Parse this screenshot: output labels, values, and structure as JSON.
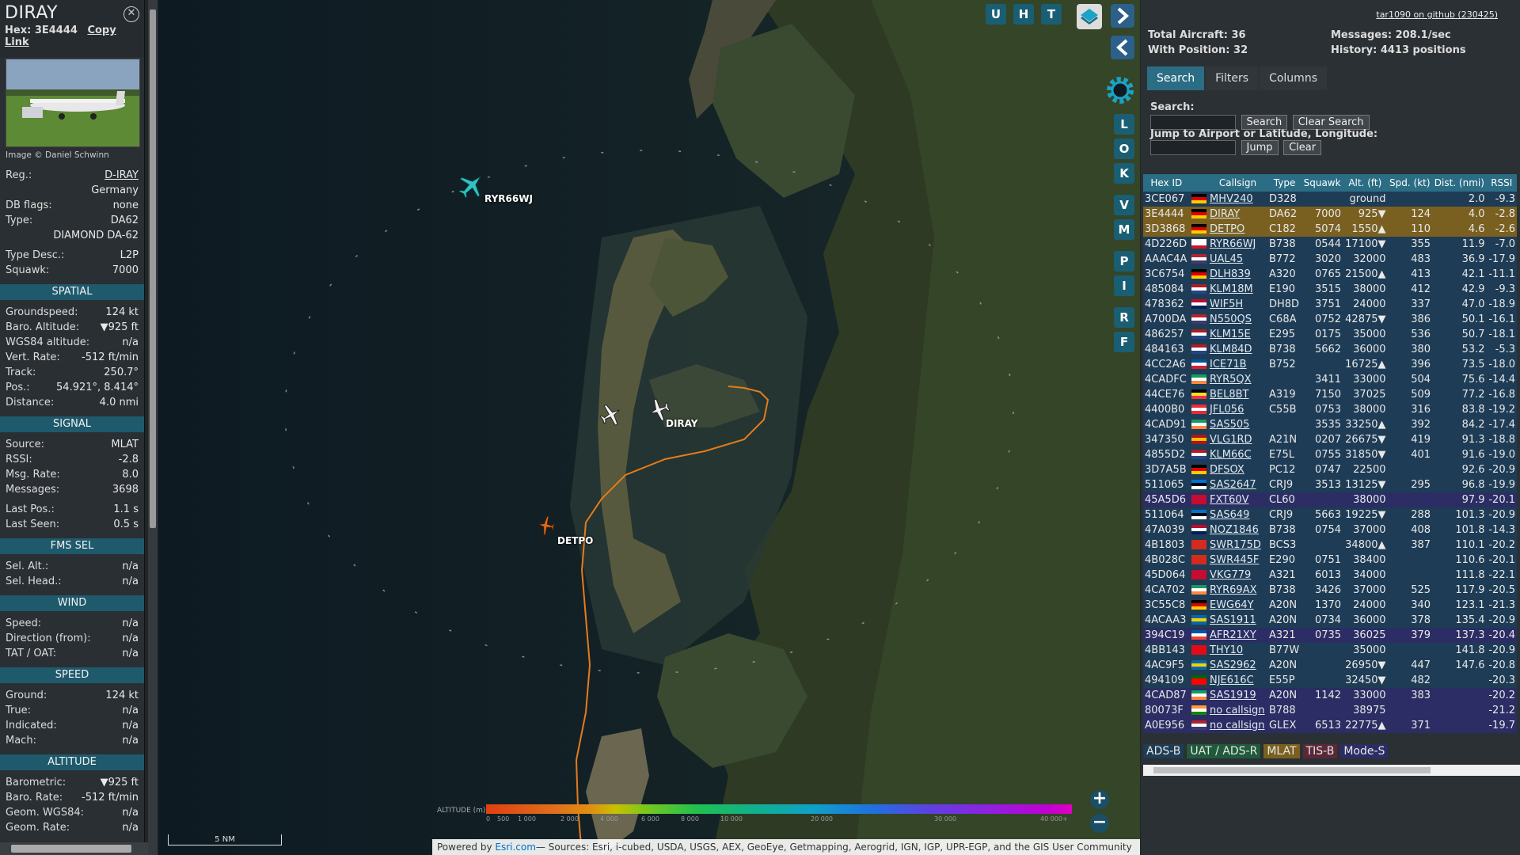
{
  "infobox": {
    "callsign": "DIRAY",
    "hex_label": "Hex:",
    "hex": "3E4444",
    "copy_link": "Copy Link",
    "image_credit": "Image © Daniel Schwinn",
    "reg_label": "Reg.:",
    "reg": "D-IRAY",
    "country": "Germany",
    "dbflags_label": "DB flags:",
    "dbflags": "none",
    "type_label": "Type:",
    "type": "DA62",
    "type_full": "DIAMOND DA-62",
    "typedesc_label": "Type Desc.:",
    "typedesc": "L2P",
    "squawk_label": "Squawk:",
    "squawk": "7000",
    "sections": {
      "spatial": "SPATIAL",
      "signal": "SIGNAL",
      "fms": "FMS SEL",
      "wind": "WIND",
      "speed": "SPEED",
      "altitude": "ALTITUDE"
    },
    "spatial": [
      {
        "k": "Groundspeed:",
        "v": "124 kt"
      },
      {
        "k": "Baro. Altitude:",
        "v": "▼925 ft"
      },
      {
        "k": "WGS84 altitude:",
        "v": "n/a"
      },
      {
        "k": "Vert. Rate:",
        "v": "-512 ft/min"
      },
      {
        "k": "Track:",
        "v": "250.7°"
      },
      {
        "k": "Pos.:",
        "v": "54.921°, 8.414°"
      },
      {
        "k": "Distance:",
        "v": "4.0 nmi"
      }
    ],
    "signal": [
      {
        "k": "Source:",
        "v": "MLAT"
      },
      {
        "k": "RSSI:",
        "v": "-2.8"
      },
      {
        "k": "Msg. Rate:",
        "v": "8.0"
      },
      {
        "k": "Messages:",
        "v": "3698"
      },
      {
        "k": "Last Pos.:",
        "v": "1.1 s"
      },
      {
        "k": "Last Seen:",
        "v": "0.5 s"
      }
    ],
    "fms": [
      {
        "k": "Sel. Alt.:",
        "v": "n/a"
      },
      {
        "k": "Sel. Head.:",
        "v": "n/a"
      }
    ],
    "wind": [
      {
        "k": "Speed:",
        "v": "n/a"
      },
      {
        "k": "Direction (from):",
        "v": "n/a"
      },
      {
        "k": "TAT / OAT:",
        "v": "n/a"
      }
    ],
    "speed": [
      {
        "k": "Ground:",
        "v": "124 kt"
      },
      {
        "k": "True:",
        "v": "n/a"
      },
      {
        "k": "Indicated:",
        "v": "n/a"
      },
      {
        "k": "Mach:",
        "v": "n/a"
      }
    ],
    "altitude": [
      {
        "k": "Barometric:",
        "v": "▼925 ft"
      },
      {
        "k": "Baro. Rate:",
        "v": "-512 ft/min"
      },
      {
        "k": "Geom. WGS84:",
        "v": "n/a"
      },
      {
        "k": "Geom. Rate:",
        "v": "n/a"
      }
    ]
  },
  "map": {
    "buttons_top": [
      "U",
      "H",
      "T"
    ],
    "side_buttons": [
      "L",
      "O",
      "K",
      "V",
      "M",
      "P",
      "I",
      "R",
      "F"
    ],
    "labels": {
      "ryr": "RYR66WJ",
      "diray": "DIRAY",
      "detpo": "DETPO"
    },
    "scale": "5 NM",
    "altitude_title": "ALTITUDE (m)",
    "altitude_ticks": [
      "0",
      "500",
      "1 000",
      "2 000",
      "4 000",
      "6 000",
      "8 000",
      "10 000",
      "20 000",
      "30 000",
      "40 000+"
    ],
    "attribution_prefix": "Powered by ",
    "attribution_link": "Esri.com",
    "attribution_rest": "— Sources: Esri, i-cubed, USDA, USGS, AEX, GeoEye, Getmapping, Aerogrid, IGN, IGP, UPR-EGP, and the GIS User Community",
    "zoom_in": "+",
    "zoom_out": "−"
  },
  "right": {
    "github": "tar1090 on github (230425)",
    "total_label": "Total Aircraft: 36",
    "withpos_label": "With Position: 32",
    "messages_label": "Messages: 208.1/sec",
    "history_label": "History: 4413 positions",
    "tabs": [
      "Search",
      "Filters",
      "Columns"
    ],
    "search_label": "Search:",
    "search_btn": "Search",
    "clear_search_btn": "Clear Search",
    "jump_label": "Jump to Airport or Latitude, Longitude:",
    "jump_btn": "Jump",
    "clear_btn": "Clear",
    "columns": [
      "Hex ID",
      "",
      "Callsign",
      "Type",
      "Squawk",
      "Alt. (ft)",
      "Spd. (kt)",
      "Dist. (nmi)",
      "RSSI"
    ],
    "rows": [
      {
        "hex": "3CE067",
        "flag": "de",
        "cs": "MHV240",
        "type": "D328",
        "sq": "",
        "alt": "ground",
        "spd": "",
        "dist": "2.0",
        "rssi": "-9.3",
        "cls": "r"
      },
      {
        "hex": "3E4444",
        "flag": "de",
        "cs": "DIRAY",
        "type": "DA62",
        "sq": "7000",
        "alt": "925▼",
        "spd": "124",
        "dist": "4.0",
        "rssi": "-2.8",
        "cls": "sel"
      },
      {
        "hex": "3D3868",
        "flag": "de",
        "cs": "DETPO",
        "type": "C182",
        "sq": "5074",
        "alt": "1550▲",
        "spd": "110",
        "dist": "4.6",
        "rssi": "-2.6",
        "cls": "sel"
      },
      {
        "hex": "4D226D",
        "flag": "mt",
        "cs": "RYR66WJ",
        "type": "B738",
        "sq": "0544",
        "alt": "17100▼",
        "spd": "355",
        "dist": "11.9",
        "rssi": "-7.0",
        "cls": "r"
      },
      {
        "hex": "AAAC4A",
        "flag": "us",
        "cs": "UAL45",
        "type": "B772",
        "sq": "3020",
        "alt": "32000",
        "spd": "483",
        "dist": "36.9",
        "rssi": "-17.9",
        "cls": "r"
      },
      {
        "hex": "3C6754",
        "flag": "de",
        "cs": "DLH839",
        "type": "A320",
        "sq": "0765",
        "alt": "21500▲",
        "spd": "413",
        "dist": "42.1",
        "rssi": "-11.1",
        "cls": "r"
      },
      {
        "hex": "485084",
        "flag": "nl",
        "cs": "KLM18M",
        "type": "E190",
        "sq": "3515",
        "alt": "38000",
        "spd": "412",
        "dist": "42.9",
        "rssi": "-9.3",
        "cls": "r"
      },
      {
        "hex": "478362",
        "flag": "no",
        "cs": "WIF5H",
        "type": "DH8D",
        "sq": "3751",
        "alt": "24000",
        "spd": "337",
        "dist": "47.0",
        "rssi": "-18.9",
        "cls": "r"
      },
      {
        "hex": "A700DA",
        "flag": "us",
        "cs": "N550QS",
        "type": "C68A",
        "sq": "0752",
        "alt": "42875▼",
        "spd": "386",
        "dist": "50.1",
        "rssi": "-16.1",
        "cls": "r"
      },
      {
        "hex": "486257",
        "flag": "nl",
        "cs": "KLM15E",
        "type": "E295",
        "sq": "0175",
        "alt": "35000",
        "spd": "536",
        "dist": "50.7",
        "rssi": "-18.1",
        "cls": "r"
      },
      {
        "hex": "484163",
        "flag": "nl",
        "cs": "KLM84D",
        "type": "B738",
        "sq": "5662",
        "alt": "36000",
        "spd": "380",
        "dist": "53.2",
        "rssi": "-5.3",
        "cls": "r"
      },
      {
        "hex": "4CC2A6",
        "flag": "is",
        "cs": "ICE71B",
        "type": "B752",
        "sq": "",
        "alt": "16725▲",
        "spd": "396",
        "dist": "73.5",
        "rssi": "-18.0",
        "cls": "r"
      },
      {
        "hex": "4CADFC",
        "flag": "ie",
        "cs": "RYR5QX",
        "type": "",
        "sq": "3411",
        "alt": "33000",
        "spd": "504",
        "dist": "75.6",
        "rssi": "-14.4",
        "cls": "r"
      },
      {
        "hex": "44CE76",
        "flag": "be",
        "cs": "BEL8BT",
        "type": "A319",
        "sq": "7150",
        "alt": "37025",
        "spd": "509",
        "dist": "77.2",
        "rssi": "-16.8",
        "cls": "r"
      },
      {
        "hex": "4400B0",
        "flag": "at",
        "cs": "JFL056",
        "type": "C55B",
        "sq": "0753",
        "alt": "38000",
        "spd": "316",
        "dist": "83.8",
        "rssi": "-19.2",
        "cls": "r"
      },
      {
        "hex": "4CAD91",
        "flag": "ie",
        "cs": "SAS505",
        "type": "",
        "sq": "3535",
        "alt": "33250▲",
        "spd": "392",
        "dist": "84.2",
        "rssi": "-17.4",
        "cls": "r"
      },
      {
        "hex": "347350",
        "flag": "es",
        "cs": "VLG1RD",
        "type": "A21N",
        "sq": "0207",
        "alt": "26675▼",
        "spd": "419",
        "dist": "91.3",
        "rssi": "-18.8",
        "cls": "r"
      },
      {
        "hex": "4855D2",
        "flag": "nl",
        "cs": "KLM66C",
        "type": "E75L",
        "sq": "0755",
        "alt": "31850▼",
        "spd": "401",
        "dist": "91.6",
        "rssi": "-19.0",
        "cls": "r"
      },
      {
        "hex": "3D7A5B",
        "flag": "de",
        "cs": "DFSOX",
        "type": "PC12",
        "sq": "0747",
        "alt": "22500",
        "spd": "",
        "dist": "92.6",
        "rssi": "-20.9",
        "cls": "r"
      },
      {
        "hex": "511065",
        "flag": "ee",
        "cs": "SAS2647",
        "type": "CRJ9",
        "sq": "3513",
        "alt": "13125▼",
        "spd": "295",
        "dist": "96.8",
        "rssi": "-19.9",
        "cls": "r"
      },
      {
        "hex": "45A5D6",
        "flag": "dk",
        "cs": "FXT60V",
        "type": "CL60",
        "sq": "",
        "alt": "38000",
        "spd": "",
        "dist": "97.9",
        "rssi": "-20.1",
        "cls": "mlat"
      },
      {
        "hex": "511064",
        "flag": "ee",
        "cs": "SAS649",
        "type": "CRJ9",
        "sq": "5663",
        "alt": "19225▼",
        "spd": "288",
        "dist": "101.3",
        "rssi": "-20.9",
        "cls": "r"
      },
      {
        "hex": "47A039",
        "flag": "no",
        "cs": "NOZ1846",
        "type": "B738",
        "sq": "0754",
        "alt": "37000",
        "spd": "408",
        "dist": "101.8",
        "rssi": "-14.3",
        "cls": "r"
      },
      {
        "hex": "4B1803",
        "flag": "ch",
        "cs": "SWR175D",
        "type": "BCS3",
        "sq": "",
        "alt": "34800▲",
        "spd": "387",
        "dist": "110.1",
        "rssi": "-20.2",
        "cls": "r"
      },
      {
        "hex": "4B028C",
        "flag": "ch",
        "cs": "SWR445F",
        "type": "E290",
        "sq": "0751",
        "alt": "38400",
        "spd": "",
        "dist": "110.6",
        "rssi": "-20.1",
        "cls": "r"
      },
      {
        "hex": "45D064",
        "flag": "dk",
        "cs": "VKG779",
        "type": "A321",
        "sq": "6013",
        "alt": "34000",
        "spd": "",
        "dist": "111.8",
        "rssi": "-22.1",
        "cls": "r"
      },
      {
        "hex": "4CA702",
        "flag": "ie",
        "cs": "RYR69AX",
        "type": "B738",
        "sq": "3426",
        "alt": "37000",
        "spd": "525",
        "dist": "117.9",
        "rssi": "-20.5",
        "cls": "r"
      },
      {
        "hex": "3C55C8",
        "flag": "de",
        "cs": "EWG64Y",
        "type": "A20N",
        "sq": "1370",
        "alt": "24000",
        "spd": "340",
        "dist": "123.1",
        "rssi": "-21.3",
        "cls": "r"
      },
      {
        "hex": "4ACAA3",
        "flag": "se",
        "cs": "SAS1911",
        "type": "A20N",
        "sq": "0734",
        "alt": "36000",
        "spd": "378",
        "dist": "135.4",
        "rssi": "-20.9",
        "cls": "r"
      },
      {
        "hex": "394C19",
        "flag": "fr",
        "cs": "AFR21XY",
        "type": "A321",
        "sq": "0735",
        "alt": "36025",
        "spd": "379",
        "dist": "137.3",
        "rssi": "-20.4",
        "cls": "mlat"
      },
      {
        "hex": "4BB143",
        "flag": "tr",
        "cs": "THY10",
        "type": "B77W",
        "sq": "",
        "alt": "35000",
        "spd": "",
        "dist": "141.8",
        "rssi": "-20.9",
        "cls": "r"
      },
      {
        "hex": "4AC9F5",
        "flag": "se",
        "cs": "SAS2962",
        "type": "A20N",
        "sq": "",
        "alt": "26950▼",
        "spd": "447",
        "dist": "147.6",
        "rssi": "-20.8",
        "cls": "r"
      },
      {
        "hex": "494109",
        "flag": "pt",
        "cs": "NJE616C",
        "type": "E55P",
        "sq": "",
        "alt": "32450▼",
        "spd": "482",
        "dist": "",
        "rssi": "-20.3",
        "cls": "r"
      },
      {
        "hex": "4CAD87",
        "flag": "ie",
        "cs": "SAS1919",
        "type": "A20N",
        "sq": "1142",
        "alt": "33000",
        "spd": "383",
        "dist": "",
        "rssi": "-20.2",
        "cls": "mlat"
      },
      {
        "hex": "80073F",
        "flag": "in",
        "cs": "no callsign",
        "type": "B788",
        "sq": "",
        "alt": "38975",
        "spd": "",
        "dist": "",
        "rssi": "-21.2",
        "cls": "mlat"
      },
      {
        "hex": "A0E956",
        "flag": "us",
        "cs": "no callsign",
        "type": "GLEX",
        "sq": "6513",
        "alt": "22775▲",
        "spd": "371",
        "dist": "",
        "rssi": "-19.7",
        "cls": "mlat"
      }
    ],
    "legend": [
      {
        "label": "ADS-B",
        "bg": "#1e3c55"
      },
      {
        "label": "UAT / ADS-R",
        "bg": "#215a3b"
      },
      {
        "label": "MLAT",
        "bg": "#7a6020"
      },
      {
        "label": "TIS-B",
        "bg": "#5a2838"
      },
      {
        "label": "Mode-S",
        "bg": "#2b2d64"
      }
    ]
  }
}
